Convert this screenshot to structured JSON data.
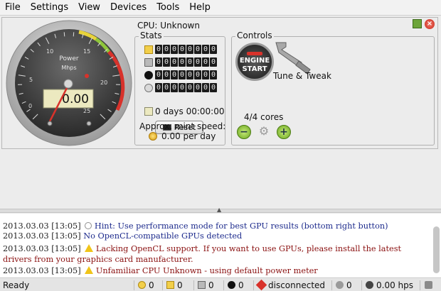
{
  "menubar": {
    "items": [
      "File",
      "Settings",
      "View",
      "Devices",
      "Tools",
      "Help"
    ]
  },
  "gauge": {
    "title": "Power",
    "unit": "Mhps",
    "reading": "0.00",
    "ticks": [
      "0",
      "5",
      "10",
      "15",
      "20",
      "25"
    ]
  },
  "cpu_title": "CPU: Unknown",
  "stats": {
    "label": "Stats",
    "rows": [
      {
        "icon": "coin-stack-icon",
        "digits": "00000000"
      },
      {
        "icon": "trash-can-icon",
        "digits": "00000000"
      },
      {
        "icon": "bomb-icon",
        "digits": "00000000"
      },
      {
        "icon": "clock-icon",
        "digits": "00000000"
      }
    ],
    "time": "0 days 00:00:00",
    "reset_label": "Reset",
    "mint_label": "Approx. mint speed:",
    "mint_value": "0.00 per day"
  },
  "controls": {
    "label": "Controls",
    "engine_line1": "ENGINE",
    "engine_line2": "START",
    "tune_label": "Tune & Tweak",
    "cores_label": "4/4 cores",
    "minus_glyph": "−",
    "plus_glyph": "+",
    "gears_glyph": "⚙"
  },
  "window": {
    "close_glyph": "×"
  },
  "splitter_glyph": "▲",
  "log": [
    {
      "ts": "2013.03.03 [13:05]",
      "icon": "hint-icon",
      "text": "Hint: Use performance mode for best GPU results (bottom right button)",
      "kind": "hint"
    },
    {
      "ts": "2013.03.03 [13:05]",
      "icon": "",
      "text": "No OpenCL-compatible GPUs detected",
      "kind": "hint"
    },
    {
      "ts": "2013.03.03 [13:05]",
      "icon": "warning-icon",
      "text": "Lacking OpenCL support. If you want to use GPUs, please install the latest drivers from your graphics card manufacturer.",
      "kind": "warn"
    },
    {
      "ts": "2013.03.03 [13:05]",
      "icon": "warning-icon",
      "text": "Unfamiliar CPU Unknown - using default power meter",
      "kind": "warn"
    }
  ],
  "status": {
    "ready": "Ready",
    "coins": "0",
    "blocks": "0",
    "trash": "0",
    "bombs": "0",
    "connection": "disconnected",
    "peers": "0",
    "hashrate": "0.00 hps"
  },
  "colors": {
    "accent_green": "#6aa51e",
    "warning_yellow": "#f0c419",
    "hint_blue": "#1c2a8c",
    "warn_red": "#8a1010"
  }
}
